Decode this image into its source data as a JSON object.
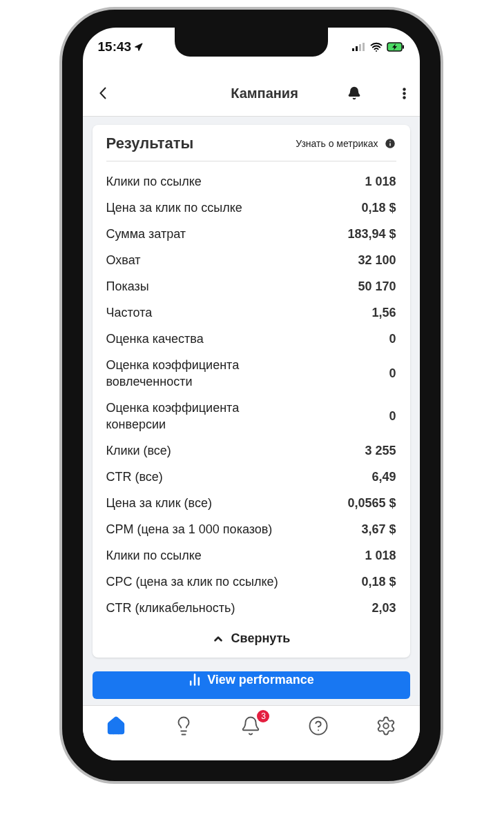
{
  "status_bar": {
    "time": "15:43"
  },
  "header": {
    "title": "Кампания"
  },
  "card": {
    "title": "Результаты",
    "help_link": "Узнать о метриках",
    "collapse": "Свернуть",
    "metrics": [
      {
        "name": "Клики по ссылке",
        "value": "1 018"
      },
      {
        "name": "Цена за клик по ссылке",
        "value": "0,18 $"
      },
      {
        "name": "Сумма затрат",
        "value": "183,94 $"
      },
      {
        "name": "Охват",
        "value": "32 100"
      },
      {
        "name": "Показы",
        "value": "50 170"
      },
      {
        "name": "Частота",
        "value": "1,56"
      },
      {
        "name": "Оценка качества",
        "value": "0"
      },
      {
        "name": "Оценка коэффициента вовлеченности",
        "value": "0"
      },
      {
        "name": "Оценка коэффициента конверсии",
        "value": "0"
      },
      {
        "name": "Клики (все)",
        "value": "3 255"
      },
      {
        "name": "CTR (все)",
        "value": "6,49"
      },
      {
        "name": "Цена за клик (все)",
        "value": "0,0565 $"
      },
      {
        "name": "CPM (цена за 1 000 показов)",
        "value": "3,67 $"
      },
      {
        "name": "Клики по ссылке",
        "value": "1 018"
      },
      {
        "name": "CPC (цена за клик по ссылке)",
        "value": "0,18 $"
      },
      {
        "name": "CTR (кликабельность)",
        "value": "2,03"
      }
    ]
  },
  "action_button": {
    "label": "View performance"
  },
  "tab_bar": [
    {
      "kind": "home",
      "selected": true
    },
    {
      "kind": "ideas",
      "selected": false
    },
    {
      "kind": "notifications",
      "selected": false,
      "badge": "3"
    },
    {
      "kind": "help",
      "selected": false
    },
    {
      "kind": "settings",
      "selected": false
    }
  ]
}
